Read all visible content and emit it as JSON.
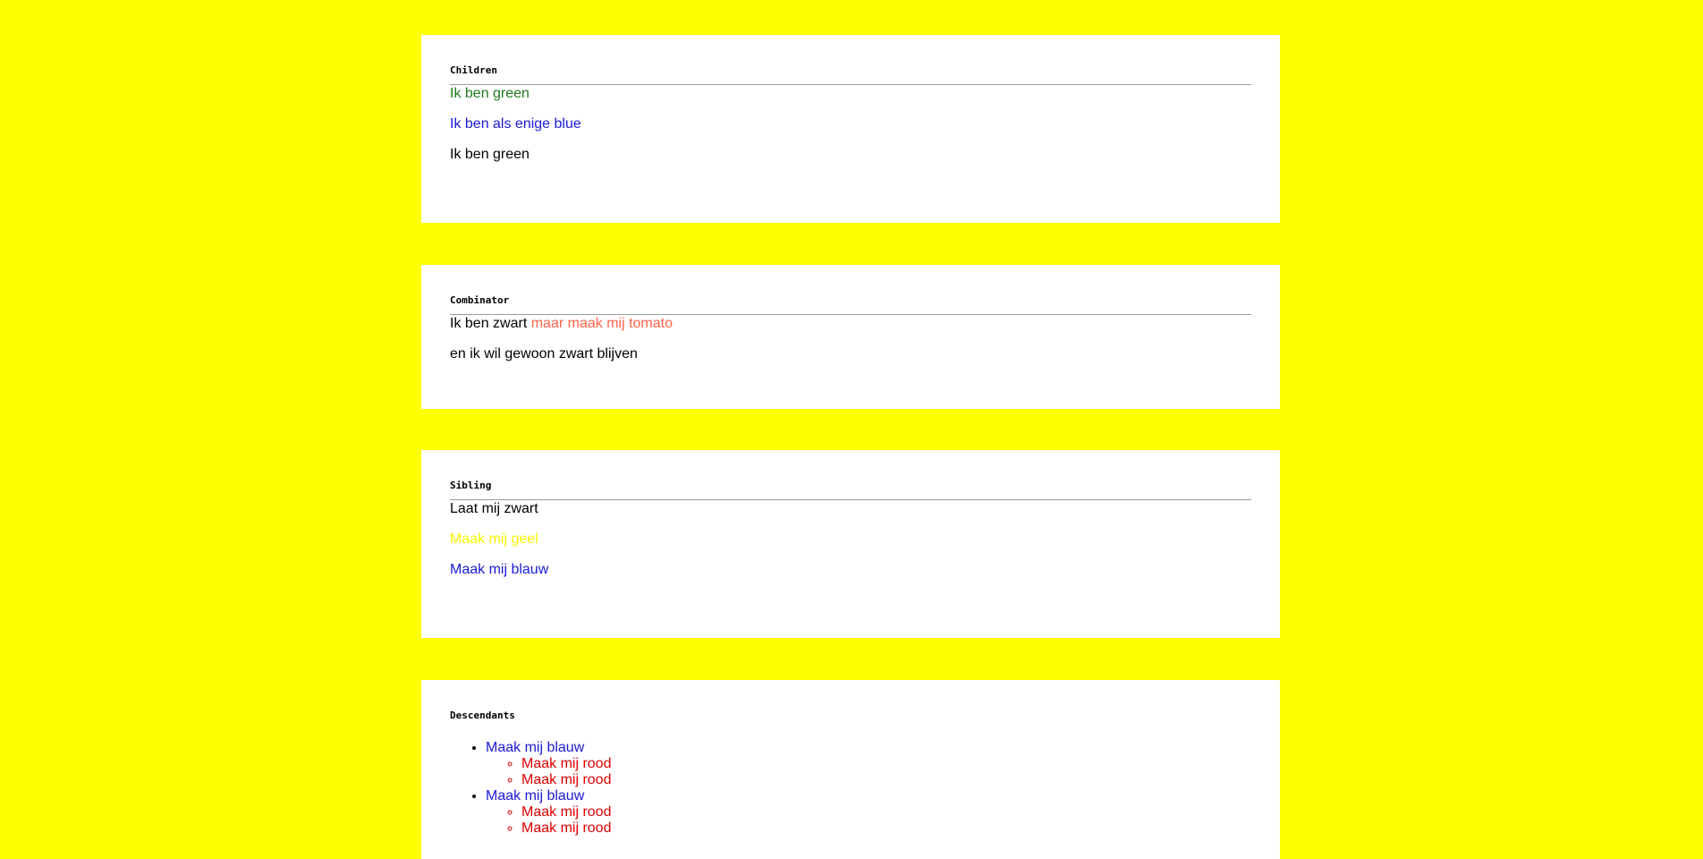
{
  "colors": {
    "page_background": "#ffff00",
    "card_background": "#ffffff",
    "green": "#1f7a1f",
    "blue": "#1a1ad6",
    "black": "#000000",
    "tomato": "#ff6347",
    "yellow": "#f7f700",
    "red": "#e00000"
  },
  "children": {
    "title": "Children",
    "line1": "Ik ben green",
    "line2": "Ik ben als enige blue",
    "line3": "Ik ben green"
  },
  "combinator": {
    "title": "Combinator",
    "line1_black": "Ik ben zwart",
    "line1_tomato": "maar maak mij tomato",
    "line2": "en ik wil gewoon zwart blijven"
  },
  "sibling": {
    "title": "Sibling",
    "line1": "Laat mij zwart",
    "line2": "Maak mij geel",
    "line3": "Maak mij blauw"
  },
  "descendants": {
    "title": "Descendants",
    "items": [
      {
        "label": "Maak mij blauw",
        "children": [
          "Maak mij rood",
          "Maak mij rood"
        ]
      },
      {
        "label": "Maak mij blauw",
        "children": [
          "Maak mij rood",
          "Maak mij rood"
        ]
      }
    ]
  }
}
